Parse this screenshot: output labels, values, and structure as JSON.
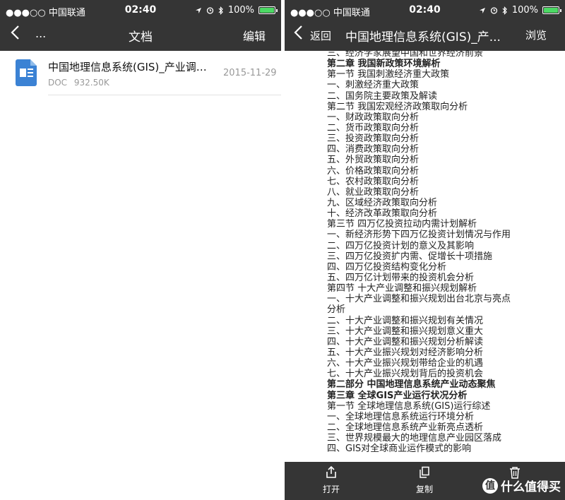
{
  "left": {
    "status": {
      "carrier": "●●●○○ 中国联通",
      "time": "02:40",
      "battery": "100%",
      "battery_level": 1.0
    },
    "nav": {
      "back_icon": "chevron-left-icon",
      "dots": "...",
      "title": "文档",
      "edit_label": "编辑"
    },
    "file": {
      "name": "中国地理信息系统(GIS)_产业调研...",
      "type": "DOC",
      "size": "932.50K",
      "date": "2015-11-29"
    }
  },
  "right": {
    "status": {
      "carrier": "●●●○○ 中国联通",
      "time": "02:40",
      "battery": "100%",
      "battery_level": 1.0
    },
    "nav": {
      "back_label": "返回",
      "title": "中国地理信息系统(GIS)_产...",
      "browse_label": "浏览"
    },
    "content_lines": [
      {
        "text": "三、经济学家展望中国和世界经济前景",
        "bold": false
      },
      {
        "text": "第二章 我国新政策环境解析",
        "bold": true
      },
      {
        "text": "第一节 我国刺激经济重大政策",
        "bold": false
      },
      {
        "text": "一、刺激经济重大政策",
        "bold": false
      },
      {
        "text": "二、国务院主要政策及解读",
        "bold": false
      },
      {
        "text": "第二节 我国宏观经济政策取向分析",
        "bold": false
      },
      {
        "text": "一、财政政策取向分析",
        "bold": false
      },
      {
        "text": "二、货币政策取向分析",
        "bold": false
      },
      {
        "text": "三、投资政策取向分析",
        "bold": false
      },
      {
        "text": "四、消费政策取向分析",
        "bold": false
      },
      {
        "text": "五、外贸政策取向分析",
        "bold": false
      },
      {
        "text": "六、价格政策取向分析",
        "bold": false
      },
      {
        "text": "七、农村政策取向分析",
        "bold": false
      },
      {
        "text": "八、就业政策取向分析",
        "bold": false
      },
      {
        "text": "九、区域经济政策取向分析",
        "bold": false
      },
      {
        "text": "十、经济改革政策取向分析",
        "bold": false
      },
      {
        "text": "第三节 四万亿投资拉动内需计划解析",
        "bold": false
      },
      {
        "text": "一、新经济形势下四万亿投资计划情况与作用",
        "bold": false
      },
      {
        "text": "二、四万亿投资计划的意义及其影响",
        "bold": false
      },
      {
        "text": "三、四万亿投资扩内需、促增长十项措施",
        "bold": false
      },
      {
        "text": "四、四万亿投资结构变化分析",
        "bold": false
      },
      {
        "text": "五、四万亿计划带来的投资机会分析",
        "bold": false
      },
      {
        "text": "第四节 十大产业调整和振兴规划解析",
        "bold": false
      },
      {
        "text": "一、十大产业调整和振兴规划出台北京与亮点",
        "bold": false
      },
      {
        "text": "分析",
        "bold": false
      },
      {
        "text": "二、十大产业调整和振兴规划有关情况",
        "bold": false
      },
      {
        "text": "三、十大产业调整和振兴规划意义重大",
        "bold": false
      },
      {
        "text": "四、十大产业调整和振兴规划分析解读",
        "bold": false
      },
      {
        "text": "五、十大产业振兴规划对经济影响分析",
        "bold": false
      },
      {
        "text": "六、十大产业振兴规划带给企业的机遇",
        "bold": false
      },
      {
        "text": "七、十大产业振兴规划背后的投资机会",
        "bold": false
      },
      {
        "text": "第二部分 中国地理信息系统产业动态聚焦",
        "bold": true
      },
      {
        "text": "第三章 全球GIS产业运行状况分析",
        "bold": true
      },
      {
        "text": "第一节 全球地理信息系统(GIS)运行综述",
        "bold": false
      },
      {
        "text": "一、全球地理信息系统运行环境分析",
        "bold": false
      },
      {
        "text": "二、全球地理信息系统产业新亮点透析",
        "bold": false
      },
      {
        "text": "三、世界规模最大的地理信息产业园区落成",
        "bold": false
      },
      {
        "text": "四、GIS对全球商业运作模式的影响",
        "bold": false
      }
    ],
    "toolbar": {
      "open_label": "打开",
      "copy_label": "复制"
    },
    "watermark": {
      "logo_glyph": "值",
      "text": "什么值得买"
    }
  }
}
